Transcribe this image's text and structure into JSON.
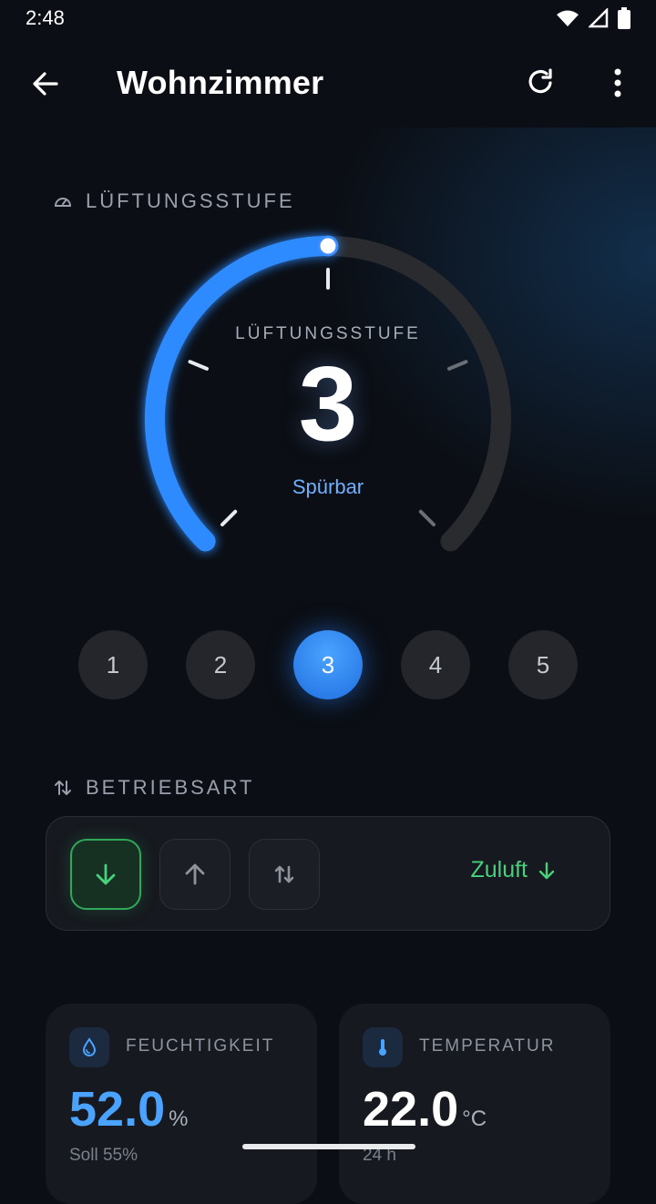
{
  "status_bar": {
    "time": "2:48"
  },
  "app_bar": {
    "title": "Wohnzimmer",
    "icons": [
      "back-arrow-icon",
      "refresh-icon",
      "more-vert-icon"
    ]
  },
  "ventilation": {
    "section_title": "LÜFTUNGSSTUFE",
    "gauge_label": "LÜFTUNGSSTUFE",
    "level": "3",
    "level_value": 3,
    "level_max": 5,
    "level_description": "Spürbar",
    "levels": [
      "1",
      "2",
      "3",
      "4",
      "5"
    ],
    "active_level": "3"
  },
  "mode": {
    "section_title": "BETRIEBSART",
    "options": [
      "supply-arrow-down-icon",
      "exhaust-arrow-up-icon",
      "balanced-arrows-icon"
    ],
    "active": "supply-arrow-down-icon",
    "current_label": "Zuluft"
  },
  "stats": {
    "humidity": {
      "title": "FEUCHTIGKEIT",
      "value": "52.0",
      "unit": "%",
      "sub": "Soll 55%"
    },
    "temperature": {
      "title": "TEMPERATUR",
      "value": "22.0",
      "unit": "°C",
      "sub": "24 h"
    }
  },
  "colors": {
    "accent": "#2f8bff",
    "mode_active": "#46d17a",
    "background": "#0b0e14",
    "card": "#16191f"
  }
}
